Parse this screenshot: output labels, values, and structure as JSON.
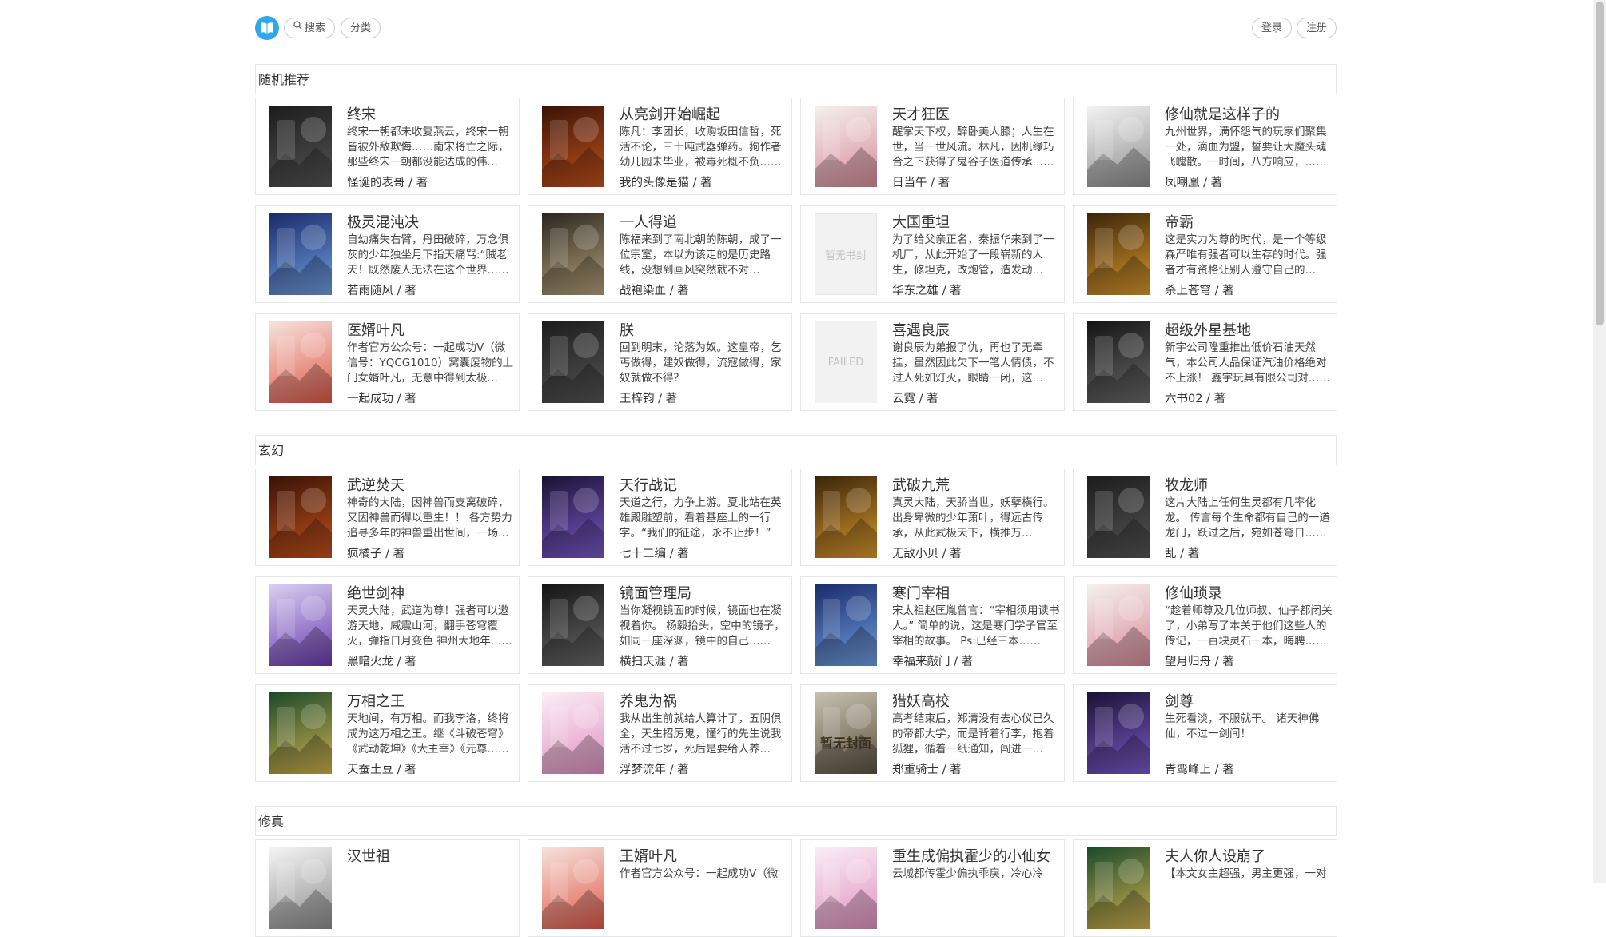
{
  "nav": {
    "search_label": "搜索",
    "category_label": "分类",
    "login_label": "登录",
    "register_label": "注册"
  },
  "sections": [
    {
      "title": "随机推荐",
      "books": [
        {
          "title": "终宋",
          "desc": "终宋一朝都未收复燕云，终宋一朝皆被外敌欺侮……南宋将亡之际，那些终宋一朝都没能达成的伟业……",
          "author": "怪诞的表哥 / 著",
          "cover": "dark"
        },
        {
          "title": "从亮剑开始崛起",
          "desc": "陈凡：李团长，收购坂田信哲，死活不论，三十吨武器弹药。狗作者幼儿园未毕业，被毒死概不负……",
          "author": "我的头像是猫 / 著",
          "cover": "fire"
        },
        {
          "title": "天才狂医",
          "desc": "醒掌天下权，醉卧美人膝；人生在世，当一世风流。林凡，因机缘巧合之下获得了鬼谷子医道传承……",
          "author": "日当午 / 著",
          "cover": "light"
        },
        {
          "title": "修仙就是这样子的",
          "desc": "九州世界，满怀怨气的玩家们聚集一处，滴血为盟，誓要让大魔头魂飞魄散。一时间，八方响应，……",
          "author": "凤嘲凰 / 著",
          "cover": "ink"
        },
        {
          "title": "极灵混沌决",
          "desc": "自幼痛失右臂，丹田破碎，万念俱灰的少年独坐月下指天痛骂:“贼老天！既然废人无法在这个世界……",
          "author": "若雨随风 / 著",
          "cover": "blue"
        },
        {
          "title": "一人得道",
          "desc": "陈福来到了南北朝的陈朝，成了一位宗室，本以为该走的是历史路线，没想到画风突然就不对了。……",
          "author": "战袍染血 / 著",
          "cover": "mist"
        },
        {
          "title": "大国重坦",
          "desc": "为了给父亲正名，秦振华来到了一机厂，从此开始了一段崭新的人生，修坦克，改炮管，造发动机……",
          "author": "华东之雄 / 著",
          "cover": "none",
          "cover_text": "暂无书封"
        },
        {
          "title": "帝霸",
          "desc": "这是实力为尊的时代，是一个等级森严唯有强者可以生存的时代。强者才有资格让别人遵守自己的戒……",
          "author": "杀上苍穹 / 著",
          "cover": "gold"
        },
        {
          "title": "医婿叶凡",
          "desc": "作者官方公众号：一起成功V（微信号：YQCG1010）窝囊废物的上门女婿叶凡，无意中得到太极经……",
          "author": "一起成功 / 著",
          "cover": "girl"
        },
        {
          "title": "朕",
          "desc": "回到明末，沦落为奴。这皇帝，乞丐做得，建奴做得，流寇做得，家奴就做不得？",
          "author": "王梓钧 / 著",
          "cover": "dark"
        },
        {
          "title": "喜遇良辰",
          "desc": "谢良辰为弟报了仇，再也了无牵挂，虽然因此欠下一笔人情债，不过人死如灯灭，眼睛一闭，这债……",
          "author": "云霓 / 著",
          "cover": "failed",
          "cover_text": "FAILED"
        },
        {
          "title": "超级外星基地",
          "desc": "新宇公司隆重推出低价石油天然气，本公司人品保证汽油价格绝对不上涨！ 鑫宇玩具有限公司对……",
          "author": "六书02 / 著",
          "cover": "mech"
        }
      ]
    },
    {
      "title": "玄幻",
      "books": [
        {
          "title": "武逆焚天",
          "desc": "神奇的大陆，因神兽而支离破碎，又因神兽而得以重生！！ 各方势力追寻多年的神兽重出世间，一场腥……",
          "author": "疯橘子 / 著",
          "cover": "fire"
        },
        {
          "title": "天行战记",
          "desc": "天道之行，力争上游。夏北站在英雄殿雕塑前，看着基座上的一行字。“我们的征途，永不止步！”",
          "author": "七十二编 / 著",
          "cover": "purple"
        },
        {
          "title": "武破九荒",
          "desc": "真灵大陆，天骄当世，妖孽横行。出身卑微的少年萧叶，得远古传承，从此武极天下，横推万敌。……",
          "author": "无敌小贝 / 著",
          "cover": "gold"
        },
        {
          "title": "牧龙师",
          "desc": "这片大陆上任何生灵都有几率化龙。 传言每个生命都有自己的一道龙门，跃过之后，宛如苍穹日……",
          "author": "乱 / 著",
          "cover": "dark"
        },
        {
          "title": "绝世剑神",
          "desc": "天灵大陆，武道为尊！强者可以遨游天地，威震山河，翻手苍穹覆灭，弹指日月变色 神州大地年……",
          "author": "黑暗火龙 / 著",
          "cover": "violet"
        },
        {
          "title": "镜面管理局",
          "desc": "当你凝视镜面的时候，镜面也在凝视着你。 杨毅抬头，空中的镜子，如同一座深渊，镜中的自己……",
          "author": "横扫天涯 / 著",
          "cover": "mech"
        },
        {
          "title": "寒门宰相",
          "desc": "宋太祖赵匡胤曾言：“宰相须用读书人。” 简单的说，这是寒门学子官至宰相的故事。 Ps:已经三本……",
          "author": "幸福来敲门 / 著",
          "cover": "blue"
        },
        {
          "title": "修仙琐录",
          "desc": "“趁着师尊及几位师叔、仙子都闭关了，小弟写了本关于他们这些人的传记，一百块灵石一本，晦聘……",
          "author": "望月归舟 / 著",
          "cover": "light"
        },
        {
          "title": "万相之王",
          "desc": "天地间，有万相。而我李洛，终将成为这万相之王。继《斗破苍穹》《武动乾坤》《大主宰》《元尊……",
          "author": "天蚕土豆 / 著",
          "cover": "green"
        },
        {
          "title": "养鬼为祸",
          "desc": "我从出生前就给人算计了，五阴俱全，天生招厉鬼，懂行的先生说我活不过七岁，死后是要给人养成……",
          "author": "浮梦流年 / 著",
          "cover": "pink"
        },
        {
          "title": "猎妖高校",
          "desc": "高考结束后，郑清没有去心仪已久的帝都大学，而是背着行李，抱着狐狸，循着一纸通知，闯进一座……",
          "author": "郑重骑士 / 著",
          "cover": "city",
          "cover_text": "暂无封面"
        },
        {
          "title": "剑尊",
          "desc": "生死看淡，不服就干。 诸天神佛仙，不过一剑间！",
          "author": "青鸾峰上 / 著",
          "cover": "purple"
        }
      ]
    },
    {
      "title": "修真",
      "books": [
        {
          "title": "汉世祖",
          "desc": "",
          "author": "",
          "cover": "ink"
        },
        {
          "title": "王婿叶凡",
          "desc": "作者官方公众号：一起成功V（微",
          "author": "",
          "cover": "girl"
        },
        {
          "title": "重生成偏执霍少的小仙女",
          "desc": "云城都传霍少偏执乖戾，冷心冷",
          "author": "",
          "cover": "pink"
        },
        {
          "title": "夫人你人设崩了",
          "desc": "【本文女主超强，男主更强，一对",
          "author": "",
          "cover": "green"
        }
      ]
    }
  ]
}
